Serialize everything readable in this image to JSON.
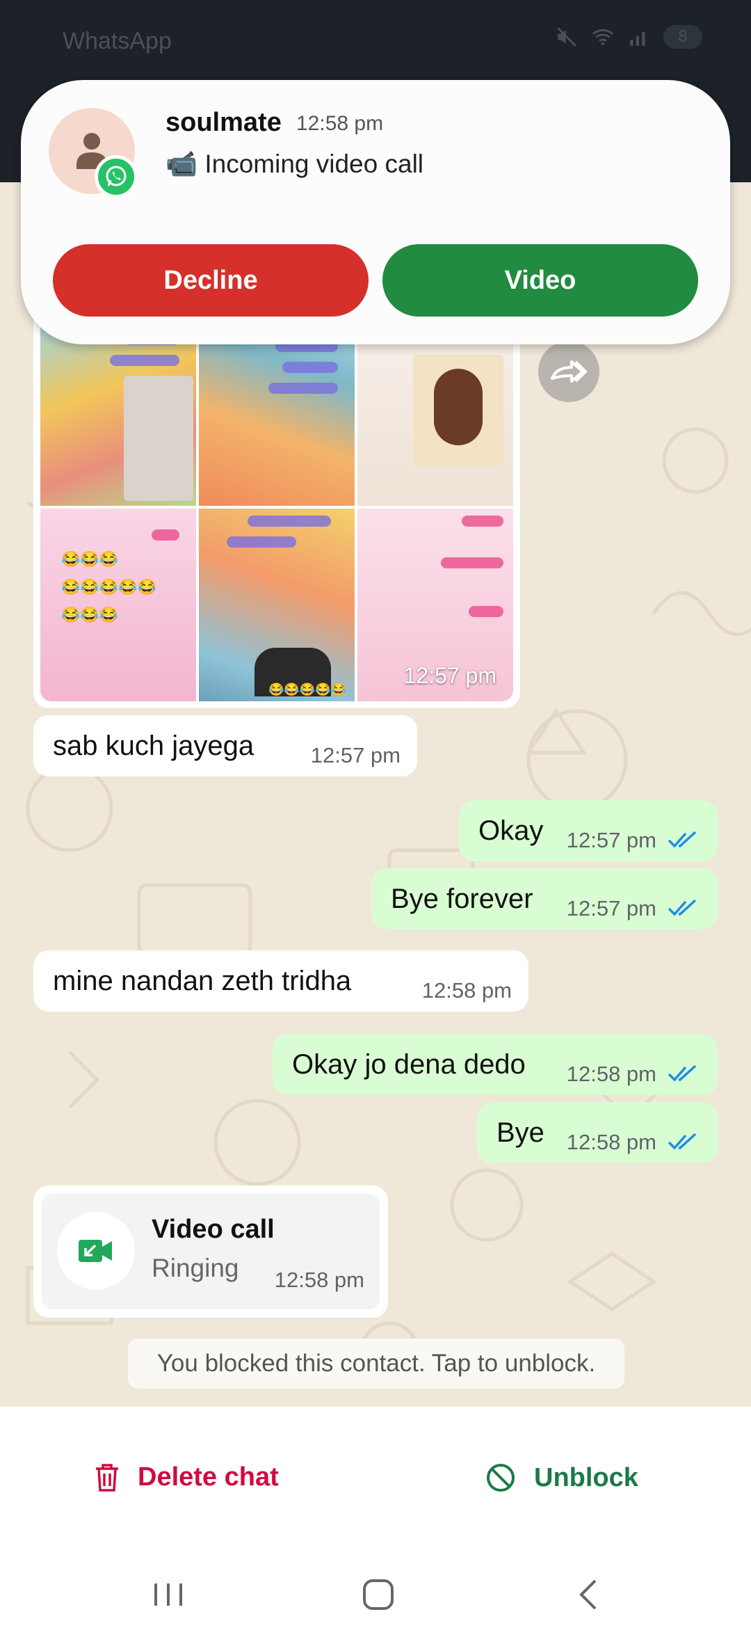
{
  "status_bar": {
    "app_title": "WhatsApp",
    "battery": "8"
  },
  "notification": {
    "contact_name": "soulmate",
    "time": "12:58 pm",
    "message": "📹 Incoming video call",
    "decline_label": "Decline",
    "accept_label": "Video"
  },
  "messages": [
    {
      "type": "image",
      "direction": "in",
      "time": "12:57 pm"
    },
    {
      "type": "text",
      "direction": "in",
      "text": "sab kuch jayega",
      "time": "12:57 pm"
    },
    {
      "type": "text",
      "direction": "out",
      "text": "Okay",
      "time": "12:57 pm",
      "read": true
    },
    {
      "type": "text",
      "direction": "out",
      "text": "Bye forever",
      "time": "12:57 pm",
      "read": true
    },
    {
      "type": "text",
      "direction": "in",
      "text": "mine nandan zeth tridha",
      "time": "12:58 pm"
    },
    {
      "type": "text",
      "direction": "out",
      "text": "Okay jo dena dedo",
      "time": "12:58 pm",
      "read": true
    },
    {
      "type": "text",
      "direction": "out",
      "text": "Bye",
      "time": "12:58 pm",
      "read": true
    }
  ],
  "call": {
    "title": "Video call",
    "status": "Ringing",
    "time": "12:58 pm"
  },
  "blocked_notice": "You blocked this contact. Tap to unblock.",
  "actions": {
    "delete_label": "Delete chat",
    "unblock_label": "Unblock"
  },
  "colors": {
    "decline": "#d6302b",
    "accept": "#218b3f",
    "outgoing_bubble": "#d9fdd3",
    "delete": "#d10a3f",
    "unblock": "#1b7a47",
    "read_ticks": "#1f8de6"
  }
}
